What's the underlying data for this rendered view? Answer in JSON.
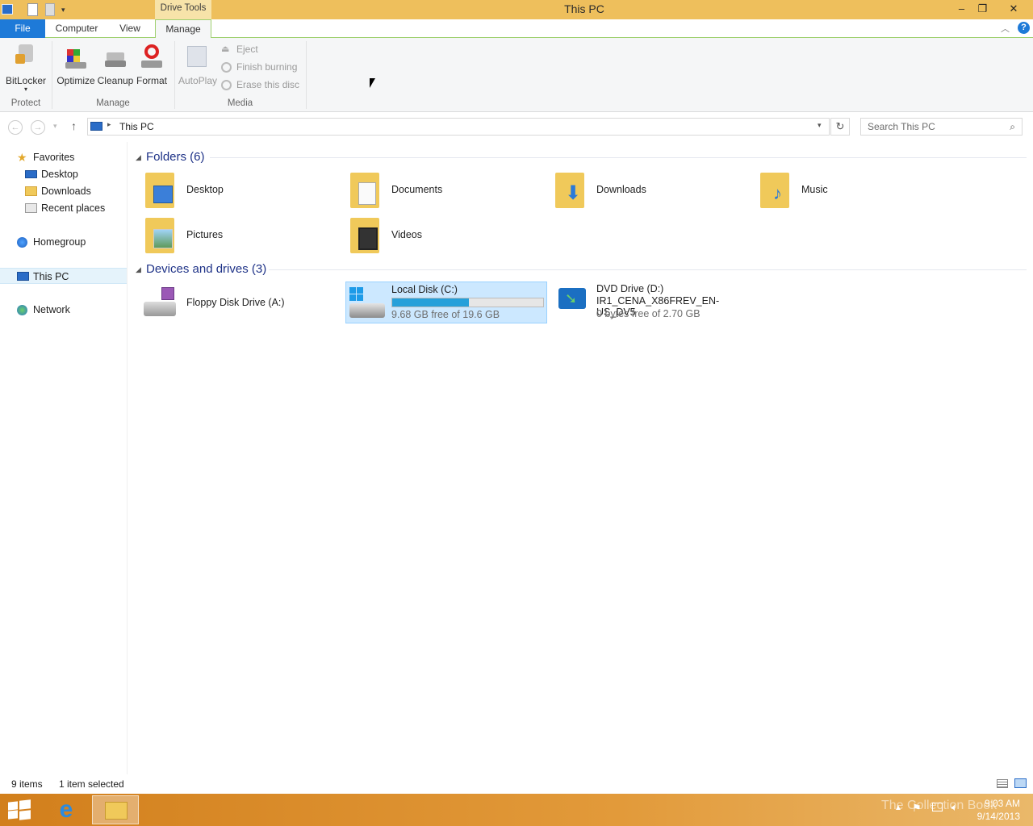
{
  "window": {
    "title": "This PC",
    "context_tab": "Drive Tools"
  },
  "colors": {
    "titlebar": "#eebf5c",
    "accent": "#1e7ad8",
    "selection": "#cce8ff",
    "drive_bar": "#26a0da",
    "folder": "#f0c95a"
  },
  "tabs": [
    {
      "label": "File"
    },
    {
      "label": "Computer"
    },
    {
      "label": "View"
    },
    {
      "label": "Manage"
    }
  ],
  "ribbon": {
    "protect": {
      "group": "Protect",
      "bitlocker": "BitLocker"
    },
    "manage": {
      "group": "Manage",
      "optimize": "Optimize",
      "cleanup": "Cleanup",
      "format": "Format"
    },
    "media": {
      "group": "Media",
      "autoplay": "AutoPlay",
      "eject": "Eject",
      "finish": "Finish burning",
      "erase": "Erase this disc"
    }
  },
  "address": {
    "path": "This PC",
    "search_placeholder": "Search This PC"
  },
  "nav": {
    "favorites": "Favorites",
    "desktop": "Desktop",
    "downloads": "Downloads",
    "recent": "Recent places",
    "homegroup": "Homegroup",
    "thispc": "This PC",
    "network": "Network"
  },
  "folders": {
    "header": "Folders (6)",
    "items": [
      "Desktop",
      "Documents",
      "Downloads",
      "Music",
      "Pictures",
      "Videos"
    ]
  },
  "drives": {
    "header": "Devices and drives (3)",
    "floppy": {
      "name": "Floppy Disk Drive (A:)"
    },
    "local": {
      "name": "Local Disk (C:)",
      "free": "9.68 GB free of 19.6 GB",
      "used_fraction": 0.506
    },
    "dvd": {
      "name": "DVD Drive (D:)",
      "label": "IR1_CENA_X86FREV_EN-US_DV5",
      "free": "0 bytes free of 2.70 GB"
    }
  },
  "status": {
    "items": "9 items",
    "selected": "1 item selected"
  },
  "taskbar": {
    "time": "9:03 AM",
    "date": "9/14/2013",
    "watermark": "The Collection Book"
  }
}
